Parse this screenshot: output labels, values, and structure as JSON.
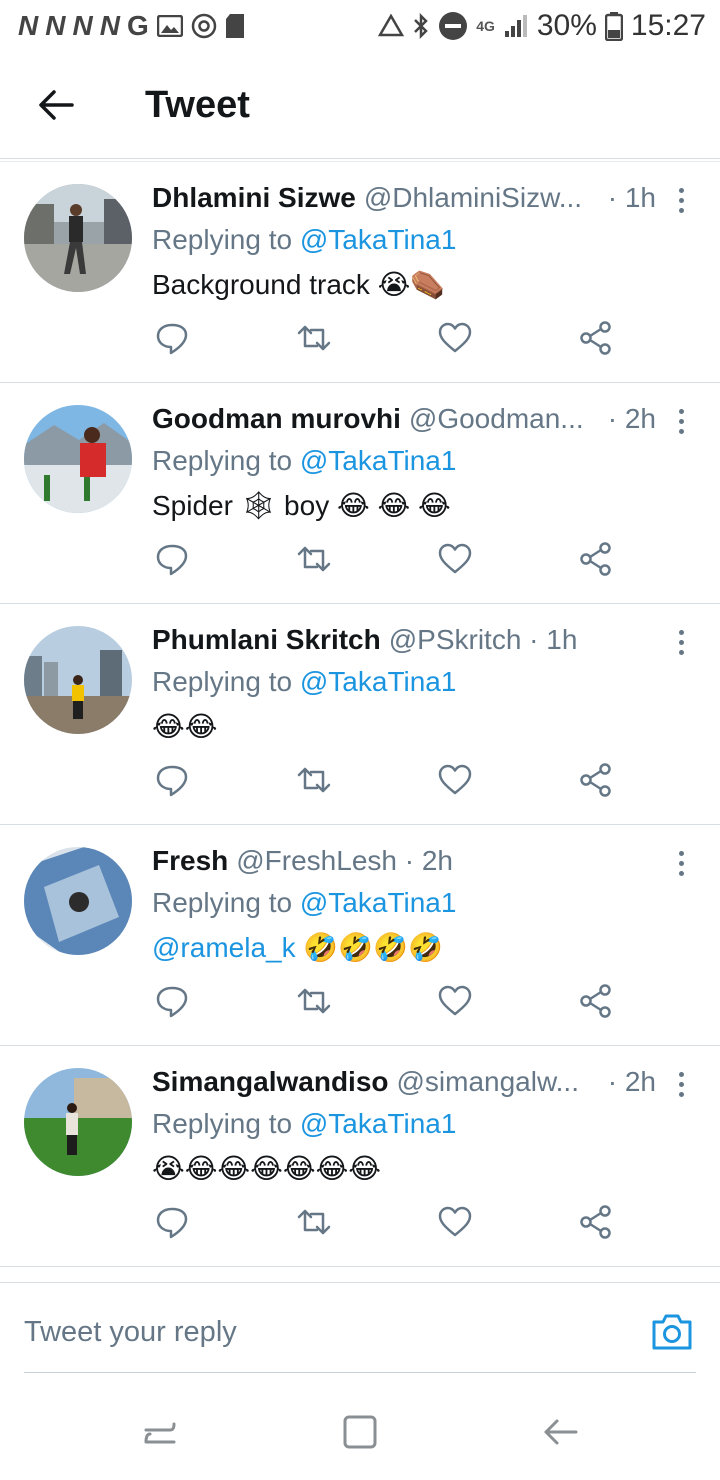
{
  "status_bar": {
    "left_glyphs": [
      "N",
      "N",
      "N",
      "N"
    ],
    "g_label": "G",
    "network": "4G",
    "battery": "30%",
    "time": "15:27"
  },
  "header": {
    "title": "Tweet"
  },
  "tweets": [
    {
      "name": "Dhlamini Sizwe",
      "handle": "@DhlaminiSizw...",
      "time": "· 1h",
      "replying_prefix": "Replying to ",
      "replying_to": "@TakaTina1",
      "body_text": "Background track 😭⚰️",
      "body_mention": ""
    },
    {
      "name": "Goodman murovhi",
      "handle": "@Goodman...",
      "time": "· 2h",
      "replying_prefix": "Replying to ",
      "replying_to": "@TakaTina1",
      "body_text": "Spider 🕸 boy 😂 😂 😂",
      "body_mention": ""
    },
    {
      "name": "Phumlani Skritch",
      "handle": "@PSkritch · 1h",
      "time": "",
      "replying_prefix": "Replying to ",
      "replying_to": "@TakaTina1",
      "body_text": "😂😂",
      "body_mention": ""
    },
    {
      "name": "Fresh",
      "handle": "@FreshLesh · 2h",
      "time": "",
      "replying_prefix": "Replying to ",
      "replying_to": "@TakaTina1",
      "body_text": " 🤣🤣🤣🤣",
      "body_mention": "@ramela_k"
    },
    {
      "name": "Simangalwandiso",
      "handle": "@simangalw...",
      "time": "· 2h",
      "replying_prefix": "Replying to ",
      "replying_to": "@TakaTina1",
      "body_text": "😭😂😂😂😂😂😂",
      "body_mention": ""
    }
  ],
  "reply_bar": {
    "placeholder": "Tweet your reply"
  },
  "colors": {
    "accent": "#1b95e0",
    "secondary_text": "#657786",
    "primary_text": "#14171a"
  }
}
